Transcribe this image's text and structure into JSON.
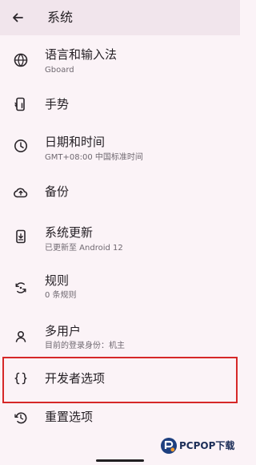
{
  "header": {
    "title": "系统"
  },
  "items": [
    {
      "label": "语言和输入法",
      "subtitle": "Gboard",
      "icon": "globe-icon"
    },
    {
      "label": "手势",
      "icon": "gesture-phone-icon"
    },
    {
      "label": "日期和时间",
      "subtitle": "GMT+08:00 中国标准时间",
      "icon": "clock-icon"
    },
    {
      "label": "备份",
      "icon": "cloud-backup-icon"
    },
    {
      "label": "系统更新",
      "subtitle": "已更新至 Android 12",
      "icon": "system-update-icon"
    },
    {
      "label": "规则",
      "subtitle": "0 条规则",
      "icon": "rules-icon"
    },
    {
      "label": "多用户",
      "subtitle": "目前的登录身份：机主",
      "icon": "user-icon"
    },
    {
      "label": "开发者选项",
      "icon": "code-braces-icon"
    },
    {
      "label": "重置选项",
      "icon": "reset-history-icon"
    }
  ],
  "watermark": {
    "text": "PCPOP下载"
  },
  "colors": {
    "background": "#fbf3f7",
    "topbar": "#f1e5ec",
    "highlight_border": "#d62828",
    "text_primary": "#241f24",
    "text_secondary": "#6f6870"
  }
}
